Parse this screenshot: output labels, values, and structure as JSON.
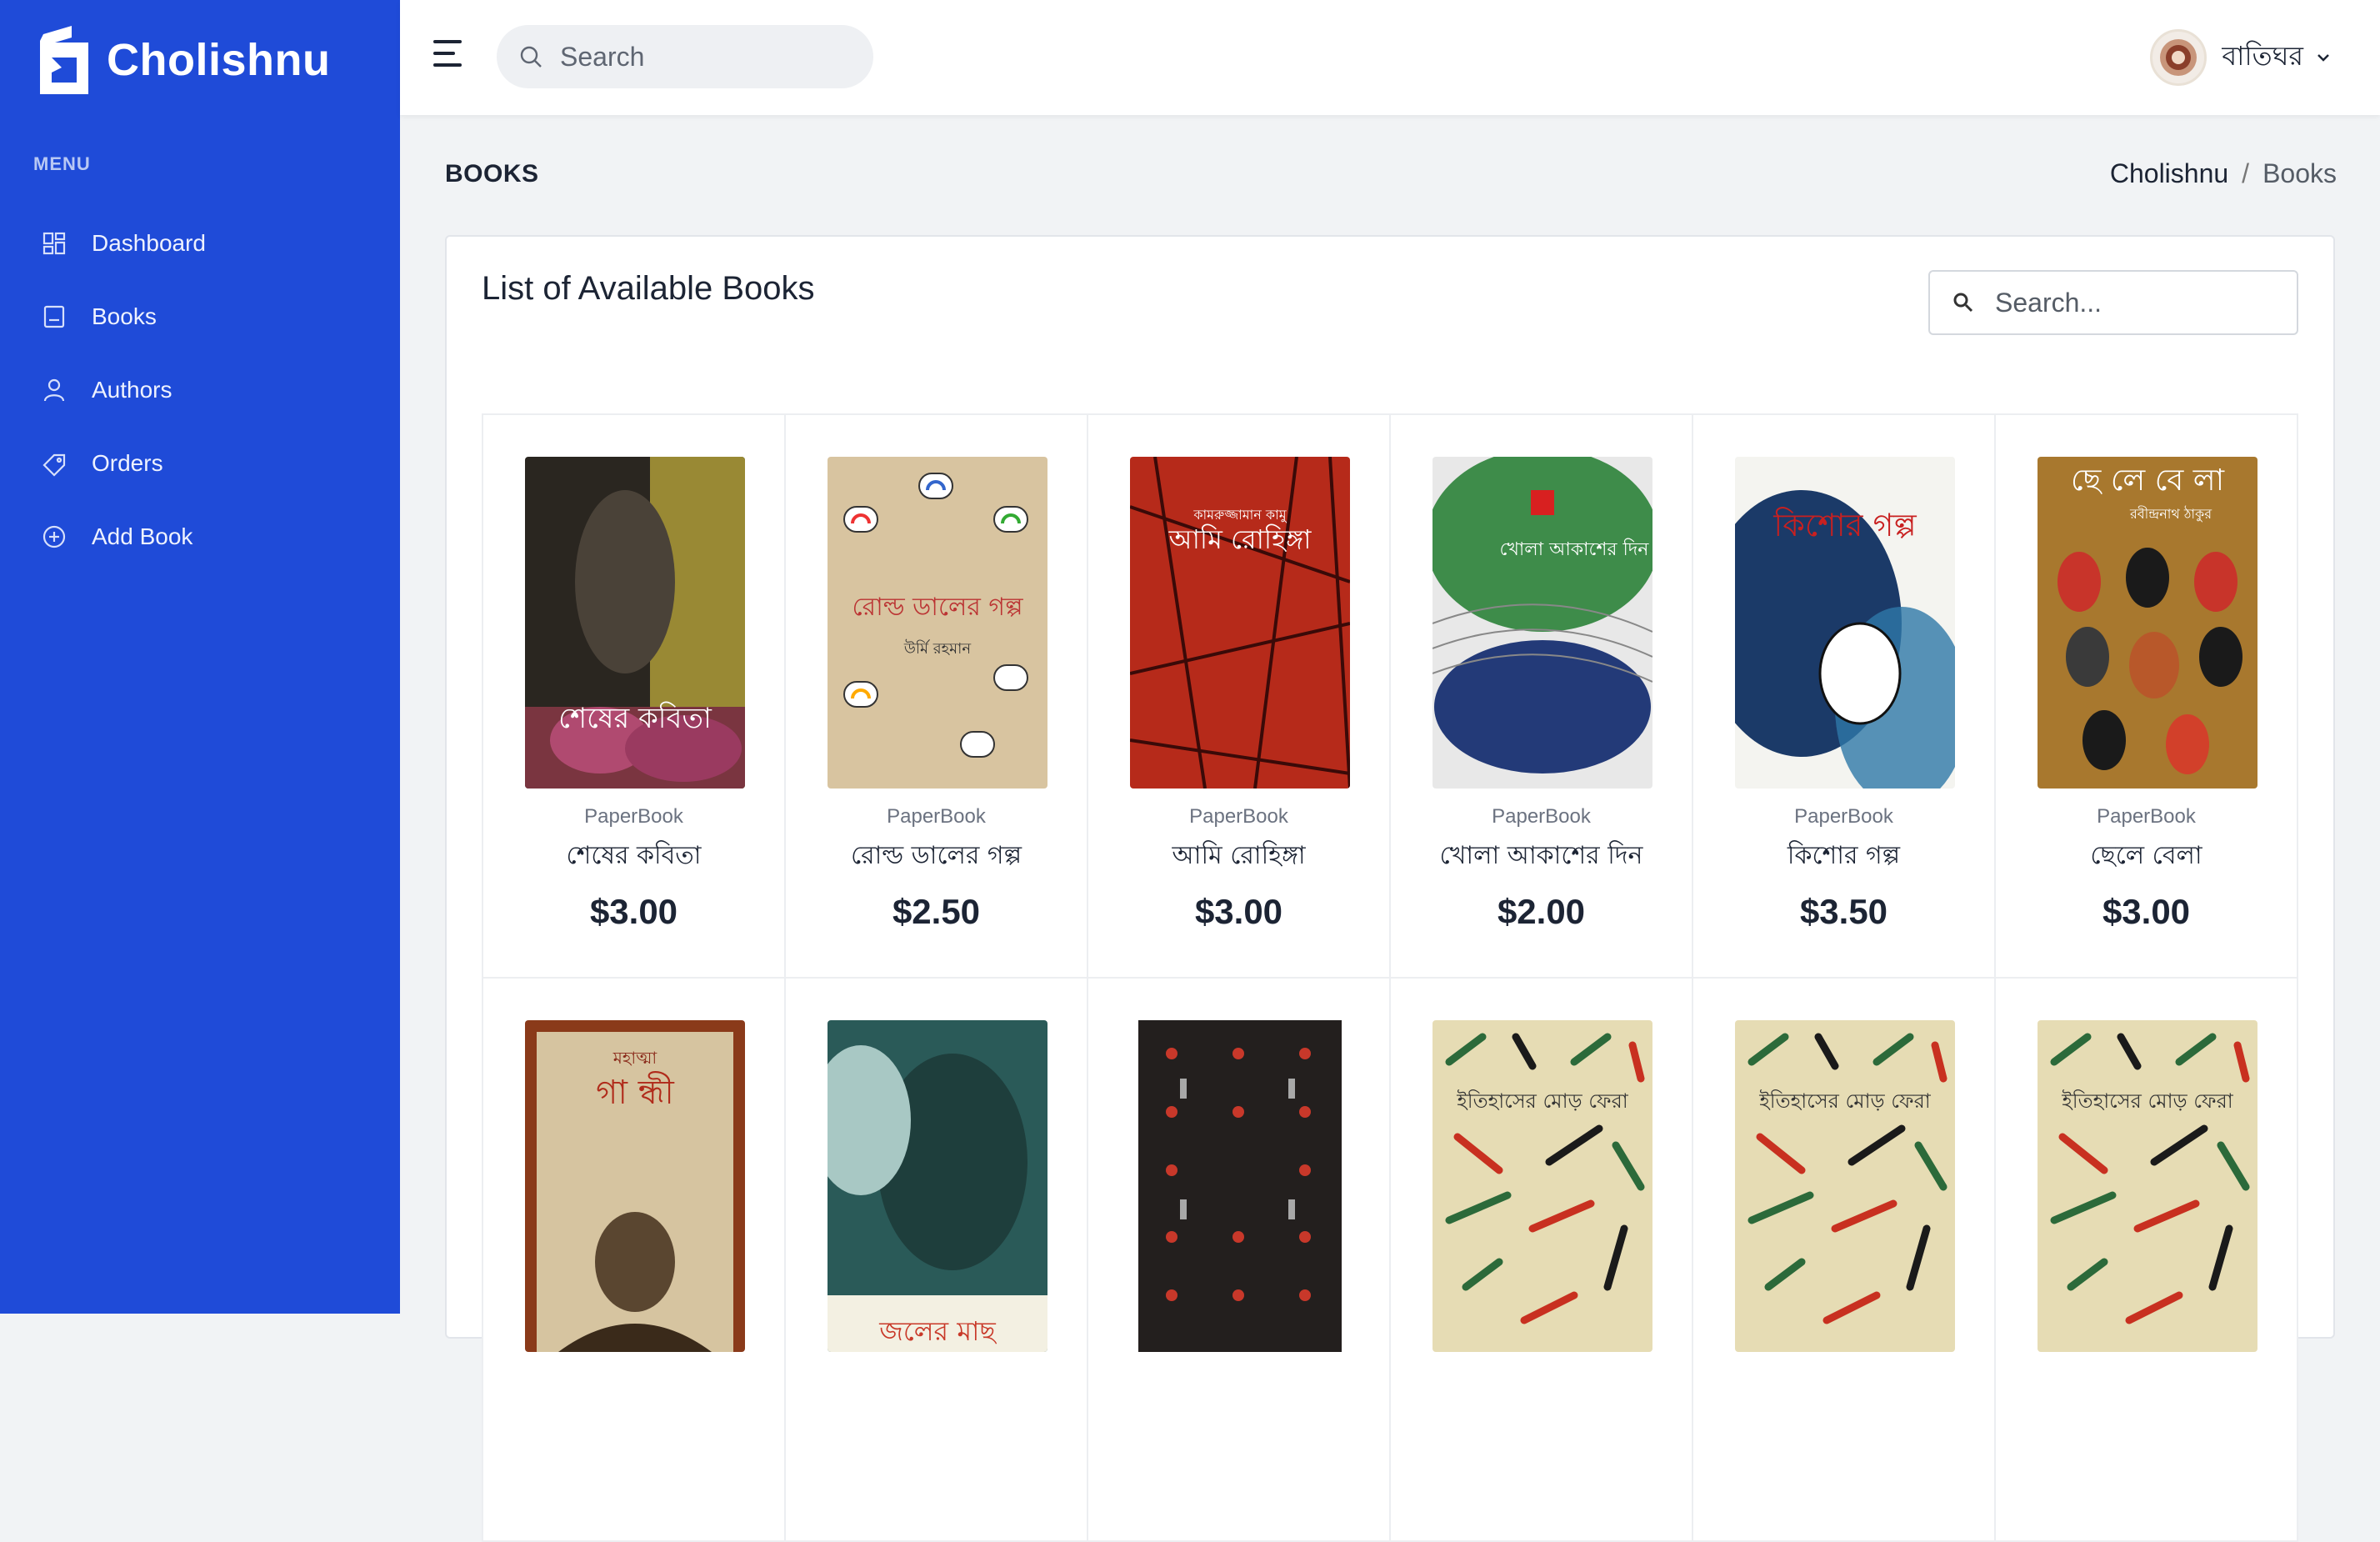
{
  "brand": {
    "name": "Cholishnu",
    "color": "#1f4bd8"
  },
  "sidebar": {
    "menu_title": "MENU",
    "items": [
      {
        "label": "Dashboard",
        "icon": "dashboard-icon"
      },
      {
        "label": "Books",
        "icon": "book-icon"
      },
      {
        "label": "Authors",
        "icon": "user-icon"
      },
      {
        "label": "Orders",
        "icon": "tag-icon"
      },
      {
        "label": "Add Book",
        "icon": "plus-circle-icon"
      }
    ]
  },
  "topbar": {
    "search_placeholder": "Search",
    "user_name": "বাতিঘর"
  },
  "page": {
    "title": "BOOKS",
    "breadcrumb": [
      "Cholishnu",
      "Books"
    ],
    "breadcrumb_sep": "/"
  },
  "card": {
    "title": "List of Available Books",
    "search_placeholder": "Search..."
  },
  "books": [
    {
      "type": "PaperBook",
      "title": "শেষের কবিতা",
      "price": "$3.00"
    },
    {
      "type": "PaperBook",
      "title": "রোল্ড ডালের গল্প",
      "price": "$2.50"
    },
    {
      "type": "PaperBook",
      "title": "আমি রোহিঙ্গা",
      "price": "$3.00"
    },
    {
      "type": "PaperBook",
      "title": "খোলা আকাশের দিন",
      "price": "$2.00"
    },
    {
      "type": "PaperBook",
      "title": "কিশোর গল্প",
      "price": "$3.50"
    },
    {
      "type": "PaperBook",
      "title": "ছেলে বেলা",
      "price": "$3.00"
    },
    {
      "type": "",
      "title": "",
      "price": ""
    },
    {
      "type": "",
      "title": "",
      "price": ""
    },
    {
      "type": "",
      "title": "",
      "price": ""
    },
    {
      "type": "",
      "title": "",
      "price": ""
    },
    {
      "type": "",
      "title": "",
      "price": ""
    },
    {
      "type": "",
      "title": "",
      "price": ""
    }
  ],
  "covers": {
    "c1": "শেষের কবিতা",
    "c2": "রোল্ড ডালের গল্প",
    "c2b": "উর্মি রহমান",
    "c3a": "কামরুজ্জামান কামু",
    "c3": "আমি রোহিঙ্গা",
    "c4": "খোলা আকাশের দিন",
    "c5": "কিশোর গল্প",
    "c6": "ছে লে বে লা",
    "c6b": "রবীন্দ্রনাথ ঠাকুর",
    "c7a": "মহাত্মা",
    "c7": "গা ন্ধী",
    "c8": "জলের মাছ",
    "c10": "ইতিহাসের মোড় ফেরা"
  }
}
